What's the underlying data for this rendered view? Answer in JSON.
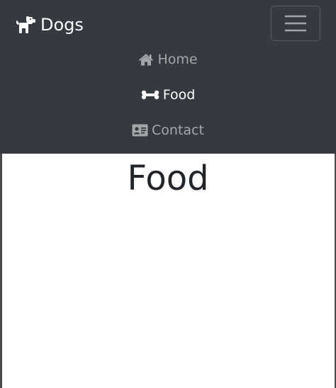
{
  "navbar": {
    "brand": {
      "icon": "dog-icon",
      "label": "Dogs"
    },
    "toggler_icon": "hamburger-icon",
    "items": [
      {
        "icon": "home-icon",
        "label": "Home",
        "active": false
      },
      {
        "icon": "bone-icon",
        "label": "Food",
        "active": true
      },
      {
        "icon": "id-card-icon",
        "label": "Contact",
        "active": false
      }
    ]
  },
  "main": {
    "title": "Food"
  },
  "colors": {
    "navbar_bg": "#343a40",
    "nav_link": "#9a9da0",
    "nav_link_active": "#ffffff",
    "title": "#212529"
  }
}
